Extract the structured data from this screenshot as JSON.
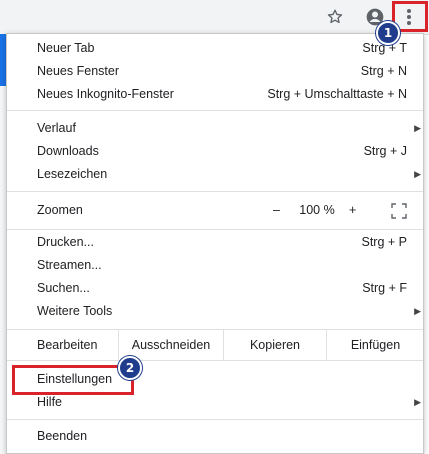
{
  "menu": {
    "group1": [
      {
        "label": "Neuer Tab",
        "shortcut": "Strg + T"
      },
      {
        "label": "Neues Fenster",
        "shortcut": "Strg + N"
      },
      {
        "label": "Neues Inkognito-Fenster",
        "shortcut": "Strg + Umschalttaste + N"
      }
    ],
    "group2": [
      {
        "label": "Verlauf"
      },
      {
        "label": "Downloads",
        "shortcut": "Strg + J"
      },
      {
        "label": "Lesezeichen"
      }
    ],
    "zoom": {
      "label": "Zoomen",
      "minus": "–",
      "value": "100 %",
      "plus": "+"
    },
    "group3": [
      {
        "label": "Drucken...",
        "shortcut": "Strg + P"
      },
      {
        "label": "Streamen..."
      },
      {
        "label": "Suchen...",
        "shortcut": "Strg + F"
      },
      {
        "label": "Weitere Tools"
      }
    ],
    "edit": {
      "label": "Bearbeiten",
      "cut": "Ausschneiden",
      "copy": "Kopieren",
      "paste": "Einfügen"
    },
    "settings": {
      "label": "Einstellungen"
    },
    "help": {
      "label": "Hilfe"
    },
    "quit": {
      "label": "Beenden"
    }
  },
  "annotations": {
    "badge1": "1",
    "badge2": "2",
    "highlight_color": "#d9232b",
    "badge_color": "#1f3d8c"
  },
  "icons": {
    "star": "star-icon",
    "profile": "account-circle-icon",
    "menu": "vertical-dots-icon",
    "fullscreen": "fullscreen-icon",
    "submenu": "triangle-right-icon"
  }
}
